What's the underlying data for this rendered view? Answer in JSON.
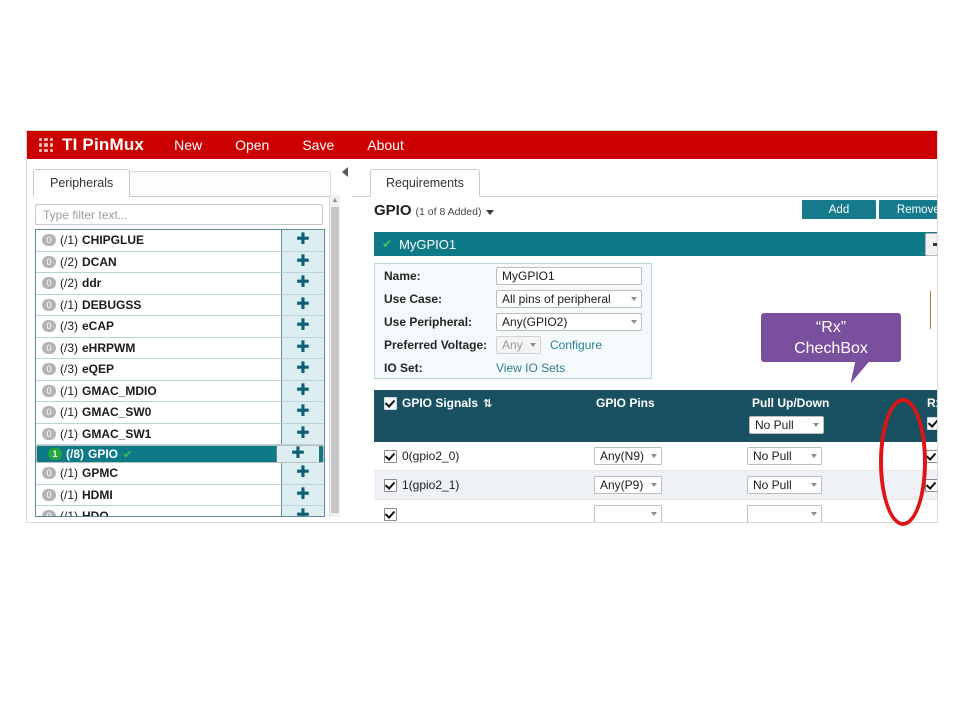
{
  "menubar": {
    "grid_icon": "grid-apps-icon",
    "brand": "TI PinMux",
    "items": [
      {
        "label": "New"
      },
      {
        "label": "Open"
      },
      {
        "label": "Save"
      },
      {
        "label": "About"
      }
    ],
    "bg_color": "#cc0000"
  },
  "left_panel": {
    "tab": "Peripherals",
    "filter": {
      "value": "",
      "placeholder": "Type filter text..."
    },
    "add_icon": "plus-icon",
    "peripherals": [
      {
        "count": "0",
        "instances": "(/1)",
        "name": "CHIPGLUE",
        "selected": false
      },
      {
        "count": "0",
        "instances": "(/2)",
        "name": "DCAN",
        "selected": false
      },
      {
        "count": "0",
        "instances": "(/2)",
        "name": "ddr",
        "selected": false
      },
      {
        "count": "0",
        "instances": "(/1)",
        "name": "DEBUGSS",
        "selected": false
      },
      {
        "count": "0",
        "instances": "(/3)",
        "name": "eCAP",
        "selected": false
      },
      {
        "count": "0",
        "instances": "(/3)",
        "name": "eHRPWM",
        "selected": false
      },
      {
        "count": "0",
        "instances": "(/3)",
        "name": "eQEP",
        "selected": false
      },
      {
        "count": "0",
        "instances": "(/1)",
        "name": "GMAC_MDIO",
        "selected": false
      },
      {
        "count": "0",
        "instances": "(/1)",
        "name": "GMAC_SW0",
        "selected": false
      },
      {
        "count": "0",
        "instances": "(/1)",
        "name": "GMAC_SW1",
        "selected": false
      },
      {
        "count": "1",
        "instances": "(/8)",
        "name": "GPIO",
        "selected": true,
        "check": "✔"
      },
      {
        "count": "0",
        "instances": "(/1)",
        "name": "GPMC",
        "selected": false
      },
      {
        "count": "0",
        "instances": "(/1)",
        "name": "HDMI",
        "selected": false
      },
      {
        "count": "0",
        "instances": "(/1)",
        "name": "HDQ",
        "selected": false
      }
    ],
    "selected_color": "#0e7a87"
  },
  "right_panel": {
    "tab": "Requirements",
    "collapse_icon": "collapse-left-icon",
    "title": "GPIO",
    "title_sub": "(1 of 8 Added)",
    "title_caret_icon": "chevron-down-icon",
    "add_button": "Add",
    "remove_all_button": "Remove All",
    "accordion": {
      "check_icon": "✔",
      "name": "MyGPIO1",
      "collapse_button_icon": "minus-icon"
    },
    "form": {
      "rows": [
        {
          "label": "Name:",
          "value": "MyGPIO1",
          "kind": "input"
        },
        {
          "label": "Use Case:",
          "value": "All pins of peripheral",
          "kind": "select"
        },
        {
          "label": "Use Peripheral:",
          "value": "Any(GPIO2)",
          "kind": "select"
        },
        {
          "label": "Preferred Voltage:",
          "value": "Any",
          "kind": "select-disabled",
          "link": "Configure"
        },
        {
          "label": "IO Set:",
          "value": "",
          "kind": "link-only",
          "link": "View IO Sets"
        }
      ]
    },
    "table": {
      "headers": [
        "GPIO Signals",
        "GPIO Pins",
        "Pull Up/Down",
        "Rx"
      ],
      "sort_icon": "⇅",
      "header_checkbox_checked": true,
      "header_pull_value": "No Pull",
      "header_rx_checked": true,
      "header_bg": "#1a5162",
      "rows": [
        {
          "signal": "0(gpio2_0)",
          "signal_checked": true,
          "pin": "Any(N9)",
          "pull": "No Pull",
          "rx_checked": true
        },
        {
          "signal": "1(gpio2_1)",
          "signal_checked": true,
          "pin": "Any(P9)",
          "pull": "No Pull",
          "rx_checked": true
        },
        {
          "signal": "",
          "signal_checked": true,
          "pin": "",
          "pull": "",
          "rx_checked": false
        }
      ]
    }
  },
  "annotations": {
    "callout": {
      "line1": "“Rx”",
      "line2": "ChechBox",
      "bg_color": "#7a4f9e",
      "text_color": "#ffffff"
    },
    "highlight_ellipse": {
      "color": "#e01414"
    }
  }
}
